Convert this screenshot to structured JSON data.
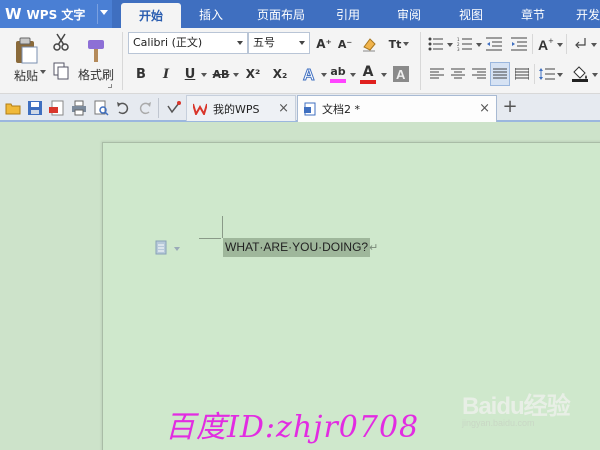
{
  "app": {
    "title": "WPS 文字",
    "logo": "W"
  },
  "menu": {
    "tabs": [
      {
        "label": "开始",
        "active": true
      },
      {
        "label": "插入"
      },
      {
        "label": "页面布局"
      },
      {
        "label": "引用"
      },
      {
        "label": "审阅"
      },
      {
        "label": "视图"
      },
      {
        "label": "章节"
      },
      {
        "label": "开发"
      }
    ]
  },
  "ribbon": {
    "paste_label": "粘贴",
    "format_painter_label": "格式刷",
    "font_name": "Calibri (正文)",
    "font_size": "五号",
    "bold": "B",
    "italic": "I",
    "underline": "U",
    "strikethrough": "AB",
    "superscript": "X²",
    "subscript": "X₂",
    "grow_font": "A⁺",
    "shrink_font": "A⁻",
    "font_color_letter": "A",
    "highlight_letter": "ab",
    "pinyin": "Tt",
    "colors": {
      "highlight": "#ff44ff",
      "font_color": "#e0201e",
      "accent": "#3f6fc0"
    }
  },
  "docbar": {
    "tabs": [
      {
        "label": "我的WPS",
        "icon": "wps-home-icon",
        "close": "×"
      },
      {
        "label": "文档2 *",
        "icon": "document-icon",
        "close": "×",
        "active": true
      }
    ],
    "new_tab": "+"
  },
  "document": {
    "text": "WHAT·ARE·YOU·DOING?",
    "paragraph_mark": "↵"
  },
  "watermark": {
    "text": "百度ID:zhjr0708",
    "brand": "Baidu经验",
    "brand_url": "jingyan.baidu.com"
  }
}
